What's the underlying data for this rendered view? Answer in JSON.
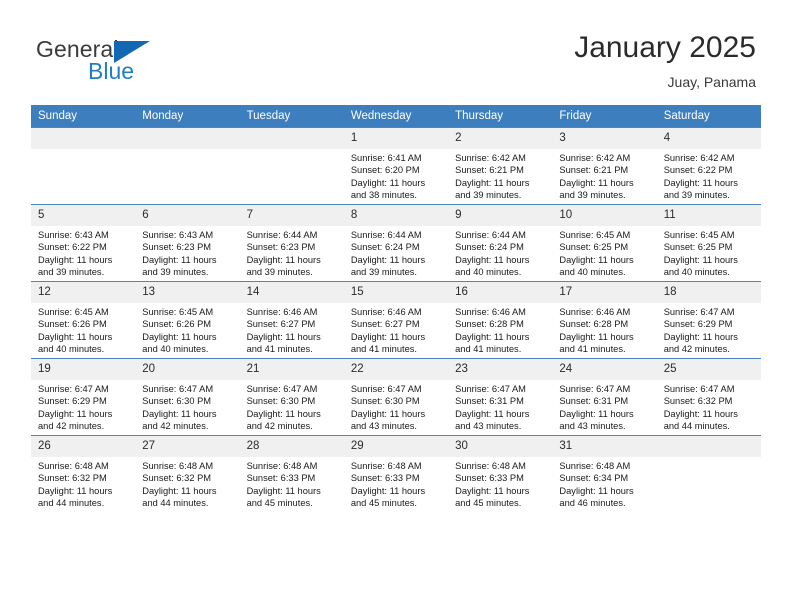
{
  "brand": {
    "name_part1": "General",
    "name_part2": "Blue",
    "triangle_color": "#1268b3",
    "blue_color": "#1f7ec4"
  },
  "header": {
    "month_title": "January 2025",
    "location": "Juay, Panama",
    "header_bg": "#3d7ebe",
    "header_text_color": "#ffffff"
  },
  "weekdays": [
    "Sunday",
    "Monday",
    "Tuesday",
    "Wednesday",
    "Thursday",
    "Friday",
    "Saturday"
  ],
  "labels": {
    "sunrise_prefix": "Sunrise:",
    "sunset_prefix": "Sunset:",
    "daylight_prefix": "Daylight:"
  },
  "weeks": [
    [
      {
        "day": "",
        "empty": true
      },
      {
        "day": "",
        "empty": true
      },
      {
        "day": "",
        "empty": true
      },
      {
        "day": "1",
        "sunrise": "Sunrise: 6:41 AM",
        "sunset": "Sunset: 6:20 PM",
        "daylight_line1": "Daylight: 11 hours",
        "daylight_line2": "and 38 minutes."
      },
      {
        "day": "2",
        "sunrise": "Sunrise: 6:42 AM",
        "sunset": "Sunset: 6:21 PM",
        "daylight_line1": "Daylight: 11 hours",
        "daylight_line2": "and 39 minutes."
      },
      {
        "day": "3",
        "sunrise": "Sunrise: 6:42 AM",
        "sunset": "Sunset: 6:21 PM",
        "daylight_line1": "Daylight: 11 hours",
        "daylight_line2": "and 39 minutes."
      },
      {
        "day": "4",
        "sunrise": "Sunrise: 6:42 AM",
        "sunset": "Sunset: 6:22 PM",
        "daylight_line1": "Daylight: 11 hours",
        "daylight_line2": "and 39 minutes."
      }
    ],
    [
      {
        "day": "5",
        "sunrise": "Sunrise: 6:43 AM",
        "sunset": "Sunset: 6:22 PM",
        "daylight_line1": "Daylight: 11 hours",
        "daylight_line2": "and 39 minutes."
      },
      {
        "day": "6",
        "sunrise": "Sunrise: 6:43 AM",
        "sunset": "Sunset: 6:23 PM",
        "daylight_line1": "Daylight: 11 hours",
        "daylight_line2": "and 39 minutes."
      },
      {
        "day": "7",
        "sunrise": "Sunrise: 6:44 AM",
        "sunset": "Sunset: 6:23 PM",
        "daylight_line1": "Daylight: 11 hours",
        "daylight_line2": "and 39 minutes."
      },
      {
        "day": "8",
        "sunrise": "Sunrise: 6:44 AM",
        "sunset": "Sunset: 6:24 PM",
        "daylight_line1": "Daylight: 11 hours",
        "daylight_line2": "and 39 minutes."
      },
      {
        "day": "9",
        "sunrise": "Sunrise: 6:44 AM",
        "sunset": "Sunset: 6:24 PM",
        "daylight_line1": "Daylight: 11 hours",
        "daylight_line2": "and 40 minutes."
      },
      {
        "day": "10",
        "sunrise": "Sunrise: 6:45 AM",
        "sunset": "Sunset: 6:25 PM",
        "daylight_line1": "Daylight: 11 hours",
        "daylight_line2": "and 40 minutes."
      },
      {
        "day": "11",
        "sunrise": "Sunrise: 6:45 AM",
        "sunset": "Sunset: 6:25 PM",
        "daylight_line1": "Daylight: 11 hours",
        "daylight_line2": "and 40 minutes."
      }
    ],
    [
      {
        "day": "12",
        "sunrise": "Sunrise: 6:45 AM",
        "sunset": "Sunset: 6:26 PM",
        "daylight_line1": "Daylight: 11 hours",
        "daylight_line2": "and 40 minutes."
      },
      {
        "day": "13",
        "sunrise": "Sunrise: 6:45 AM",
        "sunset": "Sunset: 6:26 PM",
        "daylight_line1": "Daylight: 11 hours",
        "daylight_line2": "and 40 minutes."
      },
      {
        "day": "14",
        "sunrise": "Sunrise: 6:46 AM",
        "sunset": "Sunset: 6:27 PM",
        "daylight_line1": "Daylight: 11 hours",
        "daylight_line2": "and 41 minutes."
      },
      {
        "day": "15",
        "sunrise": "Sunrise: 6:46 AM",
        "sunset": "Sunset: 6:27 PM",
        "daylight_line1": "Daylight: 11 hours",
        "daylight_line2": "and 41 minutes."
      },
      {
        "day": "16",
        "sunrise": "Sunrise: 6:46 AM",
        "sunset": "Sunset: 6:28 PM",
        "daylight_line1": "Daylight: 11 hours",
        "daylight_line2": "and 41 minutes."
      },
      {
        "day": "17",
        "sunrise": "Sunrise: 6:46 AM",
        "sunset": "Sunset: 6:28 PM",
        "daylight_line1": "Daylight: 11 hours",
        "daylight_line2": "and 41 minutes."
      },
      {
        "day": "18",
        "sunrise": "Sunrise: 6:47 AM",
        "sunset": "Sunset: 6:29 PM",
        "daylight_line1": "Daylight: 11 hours",
        "daylight_line2": "and 42 minutes."
      }
    ],
    [
      {
        "day": "19",
        "sunrise": "Sunrise: 6:47 AM",
        "sunset": "Sunset: 6:29 PM",
        "daylight_line1": "Daylight: 11 hours",
        "daylight_line2": "and 42 minutes."
      },
      {
        "day": "20",
        "sunrise": "Sunrise: 6:47 AM",
        "sunset": "Sunset: 6:30 PM",
        "daylight_line1": "Daylight: 11 hours",
        "daylight_line2": "and 42 minutes."
      },
      {
        "day": "21",
        "sunrise": "Sunrise: 6:47 AM",
        "sunset": "Sunset: 6:30 PM",
        "daylight_line1": "Daylight: 11 hours",
        "daylight_line2": "and 42 minutes."
      },
      {
        "day": "22",
        "sunrise": "Sunrise: 6:47 AM",
        "sunset": "Sunset: 6:30 PM",
        "daylight_line1": "Daylight: 11 hours",
        "daylight_line2": "and 43 minutes."
      },
      {
        "day": "23",
        "sunrise": "Sunrise: 6:47 AM",
        "sunset": "Sunset: 6:31 PM",
        "daylight_line1": "Daylight: 11 hours",
        "daylight_line2": "and 43 minutes."
      },
      {
        "day": "24",
        "sunrise": "Sunrise: 6:47 AM",
        "sunset": "Sunset: 6:31 PM",
        "daylight_line1": "Daylight: 11 hours",
        "daylight_line2": "and 43 minutes."
      },
      {
        "day": "25",
        "sunrise": "Sunrise: 6:47 AM",
        "sunset": "Sunset: 6:32 PM",
        "daylight_line1": "Daylight: 11 hours",
        "daylight_line2": "and 44 minutes."
      }
    ],
    [
      {
        "day": "26",
        "sunrise": "Sunrise: 6:48 AM",
        "sunset": "Sunset: 6:32 PM",
        "daylight_line1": "Daylight: 11 hours",
        "daylight_line2": "and 44 minutes."
      },
      {
        "day": "27",
        "sunrise": "Sunrise: 6:48 AM",
        "sunset": "Sunset: 6:32 PM",
        "daylight_line1": "Daylight: 11 hours",
        "daylight_line2": "and 44 minutes."
      },
      {
        "day": "28",
        "sunrise": "Sunrise: 6:48 AM",
        "sunset": "Sunset: 6:33 PM",
        "daylight_line1": "Daylight: 11 hours",
        "daylight_line2": "and 45 minutes."
      },
      {
        "day": "29",
        "sunrise": "Sunrise: 6:48 AM",
        "sunset": "Sunset: 6:33 PM",
        "daylight_line1": "Daylight: 11 hours",
        "daylight_line2": "and 45 minutes."
      },
      {
        "day": "30",
        "sunrise": "Sunrise: 6:48 AM",
        "sunset": "Sunset: 6:33 PM",
        "daylight_line1": "Daylight: 11 hours",
        "daylight_line2": "and 45 minutes."
      },
      {
        "day": "31",
        "sunrise": "Sunrise: 6:48 AM",
        "sunset": "Sunset: 6:34 PM",
        "daylight_line1": "Daylight: 11 hours",
        "daylight_line2": "and 46 minutes."
      },
      {
        "day": "",
        "empty": true
      }
    ]
  ]
}
